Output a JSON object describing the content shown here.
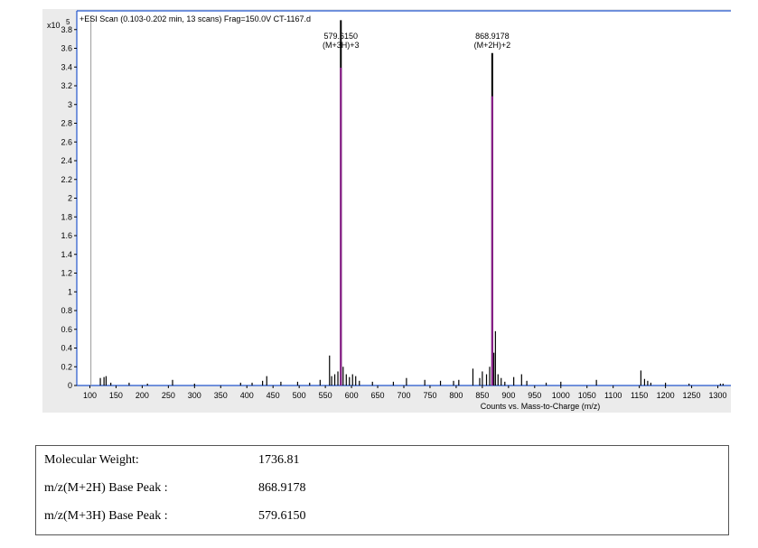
{
  "chart_data": {
    "type": "line",
    "title": "+ESI Scan (0.103-0.202 min, 13 scans) Frag=150.0V CT-1167.d",
    "xlabel": "Counts vs. Mass-to-Charge (m/z)",
    "ylabel": "",
    "y_multiplier": "x10",
    "y_exponent": "5",
    "xlim": [
      75,
      1325
    ],
    "ylim": [
      0,
      4.0
    ],
    "grid": false,
    "x_ticks": [
      100,
      150,
      200,
      250,
      300,
      350,
      400,
      450,
      500,
      550,
      600,
      650,
      700,
      750,
      800,
      850,
      900,
      950,
      1000,
      1050,
      1100,
      1150,
      1200,
      1250,
      1300
    ],
    "x_tick_labels": [
      "100",
      "150",
      "200",
      "250",
      "300",
      "350",
      "400",
      "450",
      "500",
      "550",
      "600",
      "650",
      "700",
      "750",
      "800",
      "850",
      "900",
      "950",
      "1000",
      "1050",
      "1100",
      "1150",
      "1200",
      "1250",
      "1300"
    ],
    "y_ticks": [
      0,
      0.2,
      0.4,
      0.6,
      0.8,
      1.0,
      1.2,
      1.4,
      1.6,
      1.8,
      2.0,
      2.2,
      2.4,
      2.6,
      2.8,
      3.0,
      3.2,
      3.4,
      3.6,
      3.8
    ],
    "y_tick_labels": [
      "0",
      "0.2",
      "0.4",
      "0.6",
      "0.8",
      "1",
      "1.2",
      "1.4",
      "1.6",
      "1.8",
      "2",
      "2.2",
      "2.4",
      "2.6",
      "2.8",
      "3",
      "3.2",
      "3.4",
      "3.6",
      "3.8"
    ],
    "main_peaks": [
      {
        "x": 579.615,
        "y": 3.9,
        "label_mz": "579.6150",
        "label_ion": "(M+3H)+3",
        "color": "#8b1a8b"
      },
      {
        "x": 868.9178,
        "y": 3.55,
        "label_mz": "868.9178",
        "label_ion": "(M+2H)+2",
        "color": "#8b1a8b"
      }
    ],
    "minor_peaks": [
      {
        "x": 102,
        "y": 3.95
      },
      {
        "x": 120,
        "y": 0.08
      },
      {
        "x": 127,
        "y": 0.09
      },
      {
        "x": 131,
        "y": 0.1
      },
      {
        "x": 140,
        "y": 0.03
      },
      {
        "x": 175,
        "y": 0.03
      },
      {
        "x": 210,
        "y": 0.02
      },
      {
        "x": 258,
        "y": 0.06
      },
      {
        "x": 300,
        "y": 0.02
      },
      {
        "x": 388,
        "y": 0.03
      },
      {
        "x": 410,
        "y": 0.03
      },
      {
        "x": 430,
        "y": 0.05
      },
      {
        "x": 438,
        "y": 0.1
      },
      {
        "x": 465,
        "y": 0.04
      },
      {
        "x": 497,
        "y": 0.04
      },
      {
        "x": 520,
        "y": 0.03
      },
      {
        "x": 540,
        "y": 0.06
      },
      {
        "x": 558,
        "y": 0.32
      },
      {
        "x": 562,
        "y": 0.1
      },
      {
        "x": 568,
        "y": 0.12
      },
      {
        "x": 574,
        "y": 0.15
      },
      {
        "x": 584,
        "y": 0.2
      },
      {
        "x": 590,
        "y": 0.12
      },
      {
        "x": 596,
        "y": 0.09
      },
      {
        "x": 602,
        "y": 0.12
      },
      {
        "x": 608,
        "y": 0.1
      },
      {
        "x": 615,
        "y": 0.05
      },
      {
        "x": 640,
        "y": 0.04
      },
      {
        "x": 680,
        "y": 0.04
      },
      {
        "x": 705,
        "y": 0.08
      },
      {
        "x": 740,
        "y": 0.06
      },
      {
        "x": 770,
        "y": 0.05
      },
      {
        "x": 795,
        "y": 0.05
      },
      {
        "x": 805,
        "y": 0.06
      },
      {
        "x": 832,
        "y": 0.18
      },
      {
        "x": 845,
        "y": 0.08
      },
      {
        "x": 850,
        "y": 0.15
      },
      {
        "x": 858,
        "y": 0.12
      },
      {
        "x": 864,
        "y": 0.2
      },
      {
        "x": 872,
        "y": 0.35
      },
      {
        "x": 875,
        "y": 0.58
      },
      {
        "x": 880,
        "y": 0.12
      },
      {
        "x": 886,
        "y": 0.08
      },
      {
        "x": 893,
        "y": 0.04
      },
      {
        "x": 910,
        "y": 0.09
      },
      {
        "x": 925,
        "y": 0.12
      },
      {
        "x": 935,
        "y": 0.05
      },
      {
        "x": 972,
        "y": 0.03
      },
      {
        "x": 1000,
        "y": 0.04
      },
      {
        "x": 1068,
        "y": 0.06
      },
      {
        "x": 1153,
        "y": 0.16
      },
      {
        "x": 1160,
        "y": 0.07
      },
      {
        "x": 1166,
        "y": 0.05
      },
      {
        "x": 1172,
        "y": 0.03
      },
      {
        "x": 1200,
        "y": 0.03
      },
      {
        "x": 1245,
        "y": 0.02
      },
      {
        "x": 1305,
        "y": 0.02
      },
      {
        "x": 1310,
        "y": 0.02
      }
    ]
  },
  "info_table": {
    "rows": [
      {
        "label": "Molecular Weight:",
        "value": "1736.81"
      },
      {
        "label": "m/z(M+2H) Base Peak :",
        "value": "868.9178"
      },
      {
        "label": "m/z(M+3H) Base Peak :",
        "value": "579.6150"
      }
    ]
  },
  "colors": {
    "plot_background": "#ffffff",
    "outer_background": "#ebebeb",
    "plot_frame": "#2255cc",
    "main_peak": "#8b1a8b",
    "minor_peak": "#000000"
  }
}
